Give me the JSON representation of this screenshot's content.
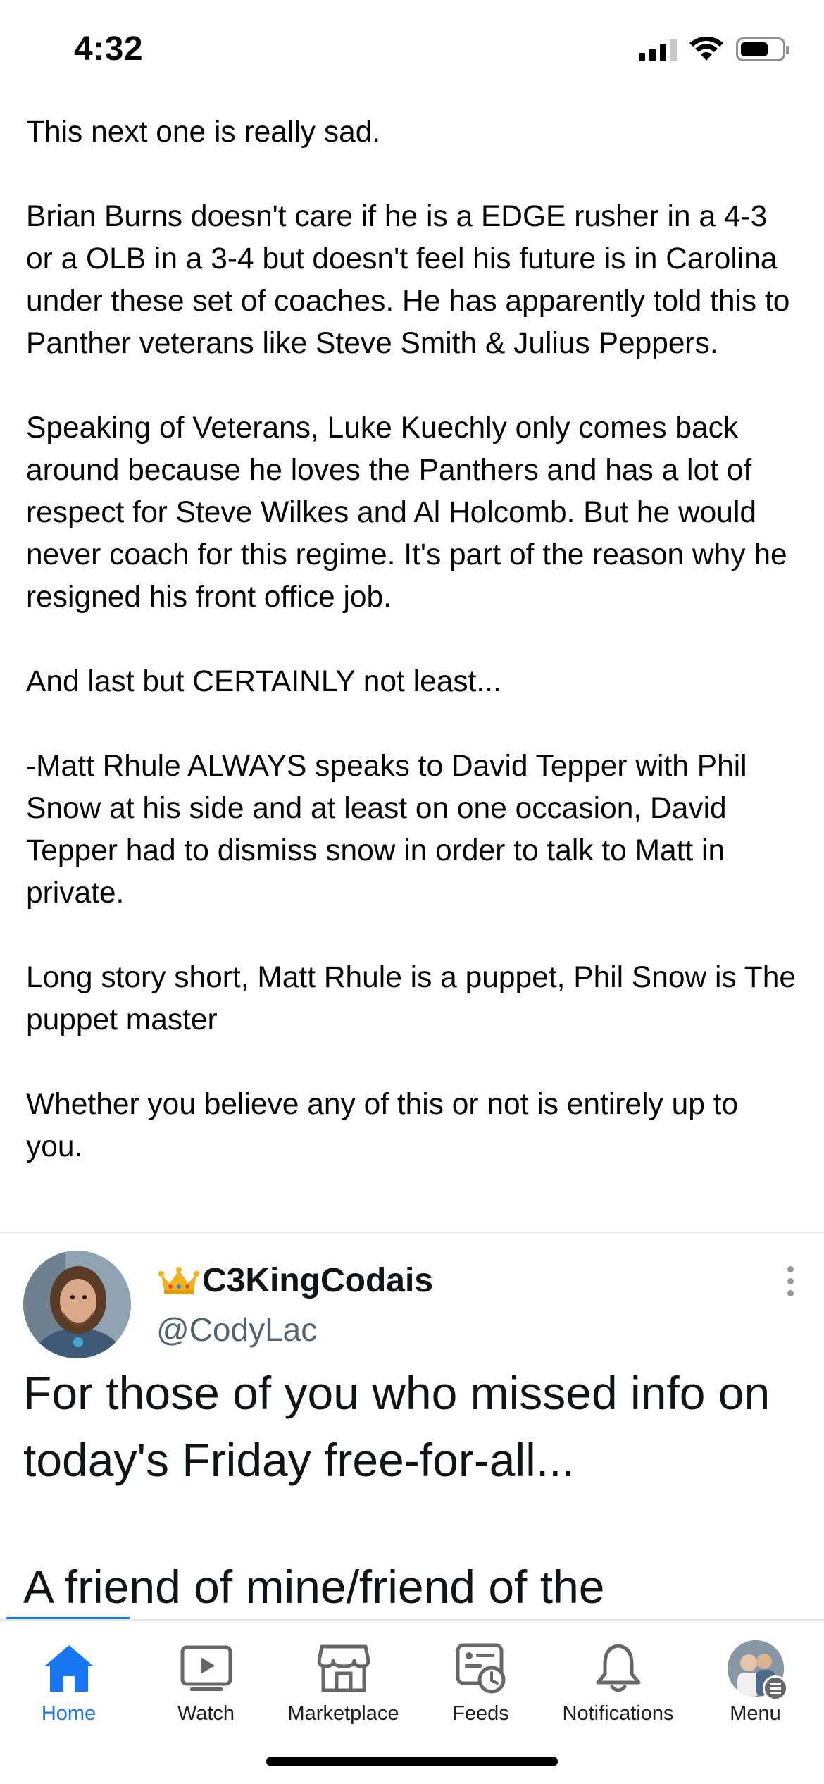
{
  "status_bar": {
    "time": "4:32"
  },
  "post": {
    "paragraphs": [
      "This next one is really sad.",
      "Brian Burns doesn't care if he is a EDGE rusher in a 4-3 or a OLB in a 3-4 but doesn't feel his future is in Carolina under these set of coaches. He has apparently told this to Panther veterans like Steve Smith & Julius Peppers.",
      "Speaking of Veterans, Luke Kuechly only comes back around because he loves the Panthers and has a lot of respect for Steve Wilkes and Al Holcomb. But he would never coach for this regime. It's part of the reason why he resigned his front office job.",
      "And last but CERTAINLY not least...",
      "-Matt Rhule ALWAYS speaks to David Tepper with Phil Snow at his side and at least on one occasion, David Tepper had to dismiss snow in order to talk to Matt in private.",
      "Long story short, Matt Rhule is a puppet, Phil Snow is The puppet master",
      "Whether you believe any of this or not is entirely up to you."
    ]
  },
  "tweet": {
    "display_name": "C3KingCodais",
    "handle": "@CodyLac",
    "text_lines": [
      "For those of you who missed info on today's Friday free-for-all...",
      "A friend of mine/friend of the"
    ]
  },
  "tab_bar": {
    "tabs": [
      {
        "label": "Home",
        "icon": "home-icon",
        "active": true
      },
      {
        "label": "Watch",
        "icon": "watch-icon",
        "active": false
      },
      {
        "label": "Marketplace",
        "icon": "marketplace-icon",
        "active": false
      },
      {
        "label": "Feeds",
        "icon": "feeds-icon",
        "active": false
      },
      {
        "label": "Notifications",
        "icon": "bell-icon",
        "active": false
      },
      {
        "label": "Menu",
        "icon": "profile-avatar",
        "active": false
      }
    ]
  },
  "colors": {
    "accent": "#1877f2",
    "text": "#050505",
    "tab_text": "#1c1e21",
    "handle_gray": "#536471"
  }
}
